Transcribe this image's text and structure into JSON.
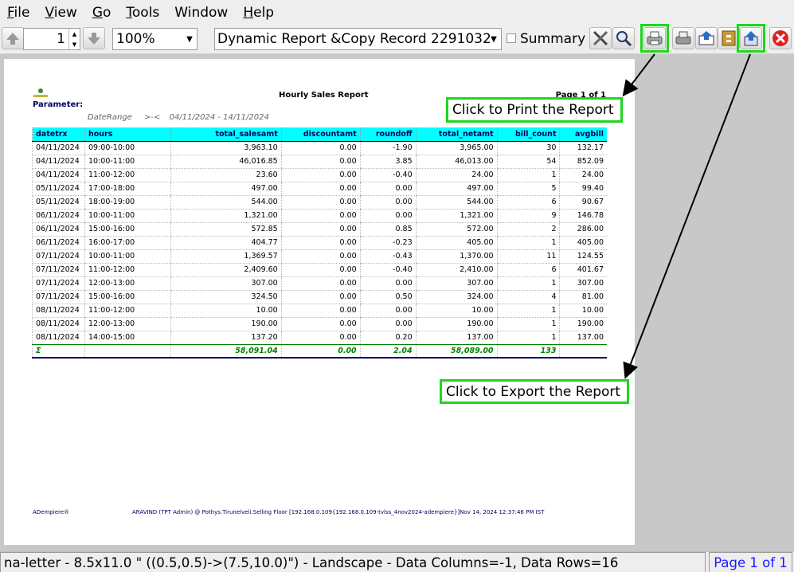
{
  "menu": [
    {
      "mnemonic": "F",
      "rest": "ile"
    },
    {
      "mnemonic": "V",
      "rest": "iew"
    },
    {
      "mnemonic": "G",
      "rest": "o"
    },
    {
      "mnemonic": "T",
      "rest": "ools"
    },
    {
      "mnemonic": "",
      "rest": "Window"
    },
    {
      "mnemonic": "H",
      "rest": "elp"
    }
  ],
  "toolbar": {
    "page_value": "1",
    "zoom_value": "100%",
    "report_select_value": "Dynamic Report &Copy Record 2291032",
    "summary_label": "Summary",
    "icons": [
      "arrow-up-icon",
      "arrow-down-icon",
      "customize-icon",
      "find-icon",
      "print-icon",
      "send-mail-icon",
      "archive-icon",
      "export-icon",
      "close-icon"
    ]
  },
  "report": {
    "title": "Hourly Sales Report",
    "page": "Page 1 of 1",
    "parameter_label": "Parameter:",
    "range_name": "DateRange",
    "range_op": ">-<",
    "range_value": "04/11/2024 - 14/11/2024",
    "columns": [
      "datetrx",
      "hours",
      "total_salesamt",
      "discountamt",
      "roundoff",
      "total_netamt",
      "bill_count",
      "avgbill"
    ],
    "rows": [
      [
        "04/11/2024",
        "09:00-10:00",
        "3,963.10",
        "0.00",
        "-1.90",
        "3,965.00",
        "30",
        "132.17"
      ],
      [
        "04/11/2024",
        "10:00-11:00",
        "46,016.85",
        "0.00",
        "3.85",
        "46,013.00",
        "54",
        "852.09"
      ],
      [
        "04/11/2024",
        "11:00-12:00",
        "23.60",
        "0.00",
        "-0.40",
        "24.00",
        "1",
        "24.00"
      ],
      [
        "05/11/2024",
        "17:00-18:00",
        "497.00",
        "0.00",
        "0.00",
        "497.00",
        "5",
        "99.40"
      ],
      [
        "05/11/2024",
        "18:00-19:00",
        "544.00",
        "0.00",
        "0.00",
        "544.00",
        "6",
        "90.67"
      ],
      [
        "06/11/2024",
        "10:00-11:00",
        "1,321.00",
        "0.00",
        "0.00",
        "1,321.00",
        "9",
        "146.78"
      ],
      [
        "06/11/2024",
        "15:00-16:00",
        "572.85",
        "0.00",
        "0.85",
        "572.00",
        "2",
        "286.00"
      ],
      [
        "06/11/2024",
        "16:00-17:00",
        "404.77",
        "0.00",
        "-0.23",
        "405.00",
        "1",
        "405.00"
      ],
      [
        "07/11/2024",
        "10:00-11:00",
        "1,369.57",
        "0.00",
        "-0.43",
        "1,370.00",
        "11",
        "124.55"
      ],
      [
        "07/11/2024",
        "11:00-12:00",
        "2,409.60",
        "0.00",
        "-0.40",
        "2,410.00",
        "6",
        "401.67"
      ],
      [
        "07/11/2024",
        "12:00-13:00",
        "307.00",
        "0.00",
        "0.00",
        "307.00",
        "1",
        "307.00"
      ],
      [
        "07/11/2024",
        "15:00-16:00",
        "324.50",
        "0.00",
        "0.50",
        "324.00",
        "4",
        "81.00"
      ],
      [
        "08/11/2024",
        "11:00-12:00",
        "10.00",
        "0.00",
        "0.00",
        "10.00",
        "1",
        "10.00"
      ],
      [
        "08/11/2024",
        "12:00-13:00",
        "190.00",
        "0.00",
        "0.00",
        "190.00",
        "1",
        "190.00"
      ],
      [
        "08/11/2024",
        "14:00-15:00",
        "137.20",
        "0.00",
        "0.20",
        "137.00",
        "1",
        "137.00"
      ]
    ],
    "total_row": [
      "Σ",
      "",
      "58,091.04",
      "0.00",
      "2.04",
      "58,089.00",
      "133",
      ""
    ],
    "footer_left": "ADempiere®",
    "footer_right": "ARAVIND (TPT Admin) @ Pothys.Tirunelveli.Selling Floor [192.168.0.109{192.168.0.109-tvlss_4nov2024-adempiere}]Nov 14, 2024 12:37:46 PM IST"
  },
  "callouts": {
    "print": "Click to Print the Report",
    "export": "Click to Export the Report"
  },
  "colors": {
    "highlight": "#1fd61f",
    "header_bg": "#00ffff",
    "total_text": "#008000"
  },
  "status": {
    "text": "na-letter - 8.5x11.0 \" ((0.5,0.5)->(7.5,10.0)\") - Landscape - Data Columns=-1, Data Rows=16",
    "page": "Page 1 of 1"
  }
}
